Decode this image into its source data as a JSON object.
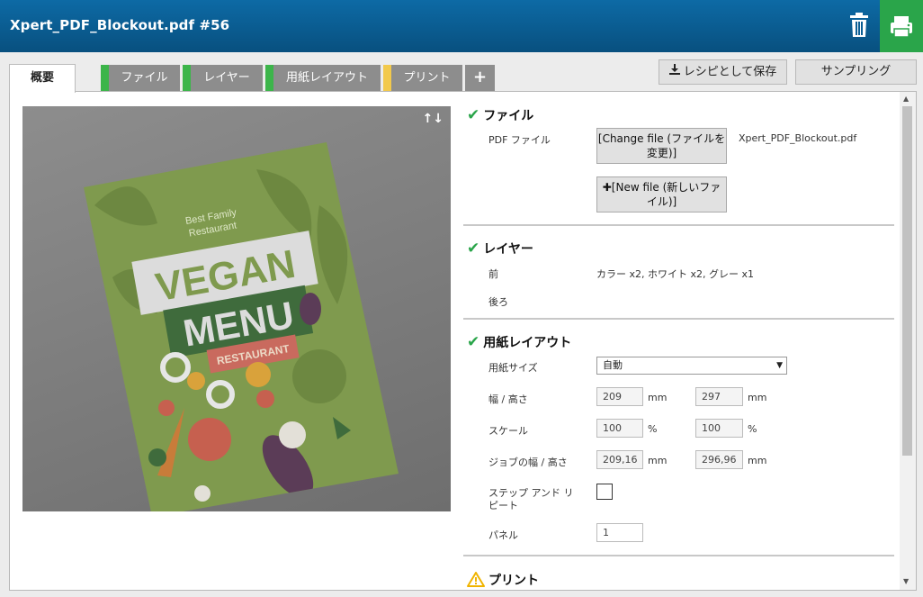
{
  "window": {
    "title": "Xpert_PDF_Blockout.pdf #56"
  },
  "icons": {
    "trash": "trash-icon",
    "print": "printer-icon"
  },
  "colors": {
    "header": "#0b5e94",
    "print_button": "#2aa54a",
    "stripe_green": "#3cb54a",
    "stripe_yellow": "#f2c94c",
    "ok_check": "#2aa54a",
    "warning": "#f0b400"
  },
  "tabs": [
    {
      "label": "概要",
      "active": true
    },
    {
      "label": "ファイル",
      "stripe": "green"
    },
    {
      "label": "レイヤー",
      "stripe": "green"
    },
    {
      "label": "用紙レイアウト",
      "stripe": "green"
    },
    {
      "label": "プリント",
      "stripe": "yellow"
    },
    {
      "label": "+"
    }
  ],
  "toolbar": {
    "save_recipe": "レシピとして保存",
    "sampling": "サンプリング"
  },
  "preview": {
    "arrows": "↑↓",
    "menu": {
      "tagline_1": "Best Family",
      "tagline_2": "Restaurant",
      "line1": "VEGAN",
      "line2": "MENU",
      "line3": "RESTAURANT"
    }
  },
  "file_section": {
    "title": "ファイル",
    "pdf_label": "PDF ファイル",
    "change_button": "[Change file (ファイルを変更)]",
    "new_button": "✚[New file (新しいファイル)]",
    "file_name": "Xpert_PDF_Blockout.pdf"
  },
  "layer_section": {
    "title": "レイヤー",
    "front_label": "前",
    "front_value": "カラー x2, ホワイト x2, グレー x1",
    "back_label": "後ろ"
  },
  "layout_section": {
    "title": "用紙レイアウト",
    "paper_size_label": "用紙サイズ",
    "paper_size_value": "自動",
    "wh_label": "幅 / 高さ",
    "width": "209",
    "height": "297",
    "unit_mm": "mm",
    "scale_label": "スケール",
    "scale_x": "100",
    "scale_y": "100",
    "unit_pct": "%",
    "job_wh_label": "ジョブの幅 / 高さ",
    "job_width": "209,16",
    "job_height": "296,96",
    "step_repeat_label_1": "ステップ アンド リ",
    "step_repeat_label_2": "ピート",
    "panel_label": "パネル",
    "panel_value": "1"
  },
  "print_section": {
    "title": "プリント"
  }
}
